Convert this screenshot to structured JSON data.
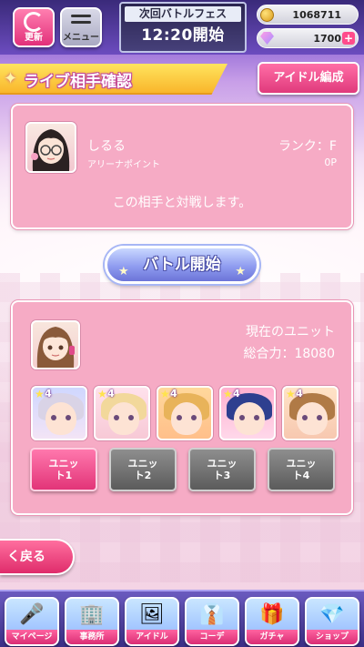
{
  "topbar": {
    "refresh_label": "更新",
    "menu_label": "メニュー",
    "fes_title": "次回バトルフェス",
    "fes_time": "12:20開始",
    "coins": "1068711",
    "jewels": "1700",
    "jewel_plus": "+"
  },
  "header": {
    "title": "ライブ相手確認",
    "idol_edit_label": "アイドル編成"
  },
  "opponent": {
    "name": "しるる",
    "arena_label": "アリーナポイント",
    "rank": "ランク：F",
    "points": "0P",
    "message": "この相手と対戦します。"
  },
  "battle_button_label": "バトル開始",
  "unit": {
    "current_label": "現在のユニット",
    "power": "総合力：18080",
    "cards": [
      {
        "rarity": "4",
        "hair": "#d9d3e6"
      },
      {
        "rarity": "4",
        "hair": "#f2d89b"
      },
      {
        "rarity": "4",
        "hair": "#e8b35a"
      },
      {
        "rarity": "4",
        "hair": "#2e3f8f"
      },
      {
        "rarity": "4",
        "hair": "#b07a46"
      }
    ],
    "tabs": [
      "ユニッ\nト1",
      "ユニッ\nト2",
      "ユニッ\nト3",
      "ユニッ\nト4"
    ],
    "active_tab": 0
  },
  "back_label": "く戻る",
  "nav": {
    "items": [
      {
        "label": "マイページ",
        "icon": "microphone-icon"
      },
      {
        "label": "事務所",
        "icon": "building-icon"
      },
      {
        "label": "アイドル",
        "icon": "idol-photos-icon"
      },
      {
        "label": "コーデ",
        "icon": "suit-icon"
      },
      {
        "label": "ガチャ",
        "icon": "gift-box-icon"
      },
      {
        "label": "ショップ",
        "icon": "diamond-icon"
      }
    ]
  },
  "colors": {
    "panel": "#f6abc5",
    "accent_pink": "#e23478",
    "ribbon_yellow": "#f9b62b",
    "nav_purple": "#3b2f86"
  }
}
